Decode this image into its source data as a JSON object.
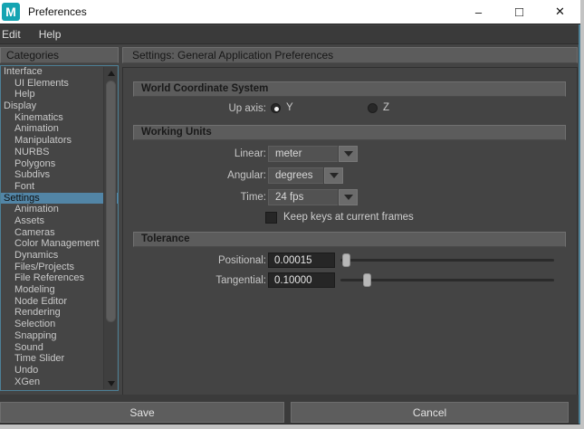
{
  "window": {
    "title": "Preferences",
    "app_icon_letter": "M",
    "controls": {
      "minimize": "–",
      "maximize": "□",
      "close": "✕"
    }
  },
  "menubar": {
    "items": [
      "Edit",
      "Help"
    ]
  },
  "sidebar": {
    "header": "Categories",
    "items": [
      {
        "label": "Interface",
        "indent": false,
        "selected": false
      },
      {
        "label": "UI Elements",
        "indent": true,
        "selected": false
      },
      {
        "label": "Help",
        "indent": true,
        "selected": false
      },
      {
        "label": "Display",
        "indent": false,
        "selected": false
      },
      {
        "label": "Kinematics",
        "indent": true,
        "selected": false
      },
      {
        "label": "Animation",
        "indent": true,
        "selected": false
      },
      {
        "label": "Manipulators",
        "indent": true,
        "selected": false
      },
      {
        "label": "NURBS",
        "indent": true,
        "selected": false
      },
      {
        "label": "Polygons",
        "indent": true,
        "selected": false
      },
      {
        "label": "Subdivs",
        "indent": true,
        "selected": false
      },
      {
        "label": "Font",
        "indent": true,
        "selected": false
      },
      {
        "label": "Settings",
        "indent": false,
        "selected": true
      },
      {
        "label": "Animation",
        "indent": true,
        "selected": false
      },
      {
        "label": "Assets",
        "indent": true,
        "selected": false
      },
      {
        "label": "Cameras",
        "indent": true,
        "selected": false
      },
      {
        "label": "Color Management",
        "indent": true,
        "selected": false
      },
      {
        "label": "Dynamics",
        "indent": true,
        "selected": false
      },
      {
        "label": "Files/Projects",
        "indent": true,
        "selected": false
      },
      {
        "label": "File References",
        "indent": true,
        "selected": false
      },
      {
        "label": "Modeling",
        "indent": true,
        "selected": false
      },
      {
        "label": "Node Editor",
        "indent": true,
        "selected": false
      },
      {
        "label": "Rendering",
        "indent": true,
        "selected": false
      },
      {
        "label": "Selection",
        "indent": true,
        "selected": false
      },
      {
        "label": "Snapping",
        "indent": true,
        "selected": false
      },
      {
        "label": "Sound",
        "indent": true,
        "selected": false
      },
      {
        "label": "Time Slider",
        "indent": true,
        "selected": false
      },
      {
        "label": "Undo",
        "indent": true,
        "selected": false
      },
      {
        "label": "XGen",
        "indent": true,
        "selected": false
      }
    ]
  },
  "main": {
    "header": "Settings: General Application Preferences",
    "world_coordinate_system": {
      "title": "World Coordinate System",
      "up_axis_label": "Up axis:",
      "options": [
        {
          "label": "Y",
          "selected": true
        },
        {
          "label": "Z",
          "selected": false
        }
      ]
    },
    "working_units": {
      "title": "Working Units",
      "linear": {
        "label": "Linear:",
        "value": "meter"
      },
      "angular": {
        "label": "Angular:",
        "value": "degrees"
      },
      "time": {
        "label": "Time:",
        "value": "24 fps"
      },
      "keep_keys": {
        "label": "Keep keys at current frames",
        "checked": false
      }
    },
    "tolerance": {
      "title": "Tolerance",
      "positional": {
        "label": "Positional:",
        "value": "0.00015",
        "slider_pos": 0.01
      },
      "tangential": {
        "label": "Tangential:",
        "value": "0.10000",
        "slider_pos": 0.11
      }
    }
  },
  "footer": {
    "save_label": "Save",
    "cancel_label": "Cancel"
  },
  "colors": {
    "selection_blue": "#5285a6",
    "focus_teal": "#4d8096",
    "panel_bg": "#444444",
    "header_bar": "#5c5c5c",
    "maya_teal": "#15a4b2",
    "titlebar_bg": "#ffffff"
  }
}
